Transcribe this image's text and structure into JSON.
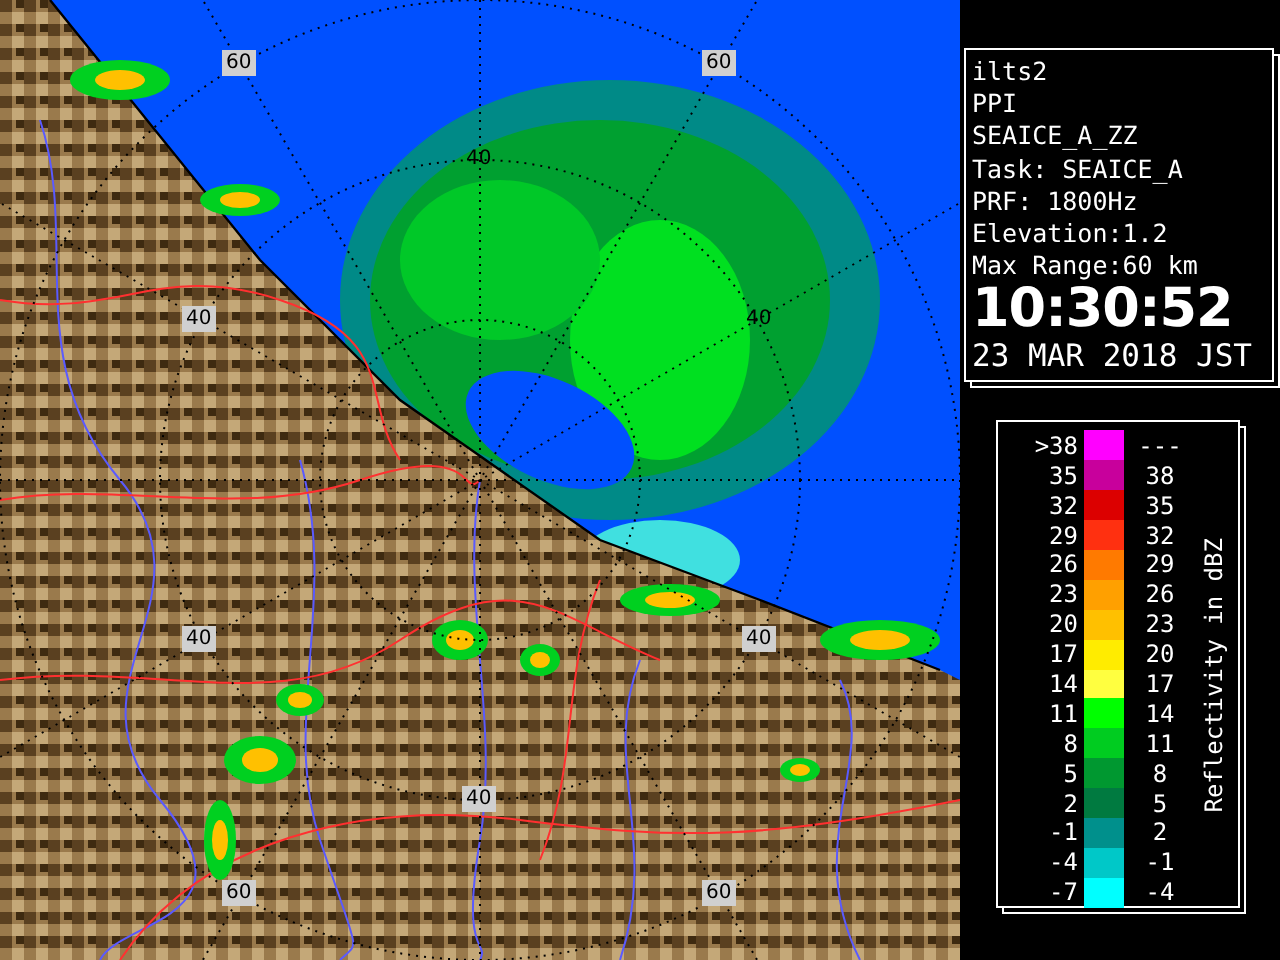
{
  "map": {
    "range_labels": [
      {
        "text": "60",
        "boxed": true
      },
      {
        "text": "60",
        "boxed": true
      },
      {
        "text": "40",
        "boxed": false
      },
      {
        "text": "40",
        "boxed": true
      },
      {
        "text": "40",
        "boxed": false
      },
      {
        "text": "40",
        "boxed": true
      },
      {
        "text": "40",
        "boxed": true
      },
      {
        "text": "40",
        "boxed": true
      },
      {
        "text": "60",
        "boxed": true
      },
      {
        "text": "60",
        "boxed": true
      }
    ]
  },
  "info": {
    "lines": [
      "ilts2",
      "PPI",
      "SEAICE_A_ZZ",
      "Task: SEAICE_A",
      "PRF: 1800Hz",
      "Elevation:1.2",
      "Max Range:60 km"
    ],
    "time": "10:30:52",
    "date": "23 MAR 2018 JST"
  },
  "legend": {
    "title": "Reflectivity in dBZ",
    "items": [
      {
        "low": ">38",
        "high": "---",
        "color": "#ff00ff"
      },
      {
        "low": "35",
        "high": "38",
        "color": "#c8009c"
      },
      {
        "low": "32",
        "high": "35",
        "color": "#dc0000"
      },
      {
        "low": "29",
        "high": "32",
        "color": "#ff3010"
      },
      {
        "low": "26",
        "high": "29",
        "color": "#ff7a00"
      },
      {
        "low": "23",
        "high": "26",
        "color": "#ffa000"
      },
      {
        "low": "20",
        "high": "23",
        "color": "#ffc000"
      },
      {
        "low": "17",
        "high": "20",
        "color": "#ffec00"
      },
      {
        "low": "14",
        "high": "17",
        "color": "#ffff40"
      },
      {
        "low": "11",
        "high": "14",
        "color": "#00ff00"
      },
      {
        "low": "8",
        "high": "11",
        "color": "#00cc20"
      },
      {
        "low": "5",
        "high": "8",
        "color": "#009830"
      },
      {
        "low": "2",
        "high": "5",
        "color": "#007a40"
      },
      {
        "low": "-1",
        "high": "2",
        "color": "#00908c"
      },
      {
        "low": "-4",
        "high": "-1",
        "color": "#00c8c8"
      },
      {
        "low": "-7",
        "high": "-4",
        "color": "#00ffff"
      }
    ]
  }
}
